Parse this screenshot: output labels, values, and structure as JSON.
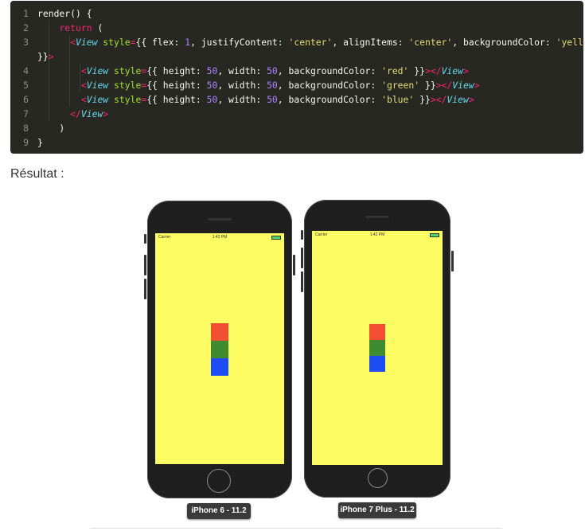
{
  "code": {
    "lines": [
      {
        "n": "1",
        "tokens": [
          {
            "t": "render",
            "c": "tk-pun"
          },
          {
            "t": "() {",
            "c": "tk-pun"
          }
        ]
      },
      {
        "n": "2",
        "tokens": [
          {
            "t": "    ",
            "c": "tk-pun"
          },
          {
            "t": "return",
            "c": "tk-kw"
          },
          {
            "t": " (",
            "c": "tk-pun"
          }
        ]
      },
      {
        "n": "3",
        "tokens": [
          {
            "t": "      ",
            "c": "tk-pun"
          },
          {
            "t": "<",
            "c": "tk-kw"
          },
          {
            "t": "View",
            "c": "tk-tag"
          },
          {
            "t": " style",
            "c": "tk-attr"
          },
          {
            "t": "=",
            "c": "tk-kw"
          },
          {
            "t": "{{ flex: ",
            "c": "tk-pun"
          },
          {
            "t": "1",
            "c": "tk-num"
          },
          {
            "t": ", justifyContent: ",
            "c": "tk-pun"
          },
          {
            "t": "'center'",
            "c": "tk-str"
          },
          {
            "t": ", alignItems: ",
            "c": "tk-pun"
          },
          {
            "t": "'center'",
            "c": "tk-str"
          },
          {
            "t": ", backgroundColor: ",
            "c": "tk-pun"
          },
          {
            "t": "'yellow'",
            "c": "tk-str"
          }
        ]
      },
      {
        "n": "",
        "tokens": [
          {
            "t": "}}",
            "c": "tk-pun"
          },
          {
            "t": ">",
            "c": "tk-kw"
          }
        ]
      },
      {
        "n": "4",
        "tokens": [
          {
            "t": "        ",
            "c": "tk-pun"
          },
          {
            "t": "<",
            "c": "tk-kw"
          },
          {
            "t": "View",
            "c": "tk-tag"
          },
          {
            "t": " style",
            "c": "tk-attr"
          },
          {
            "t": "=",
            "c": "tk-kw"
          },
          {
            "t": "{{ height: ",
            "c": "tk-pun"
          },
          {
            "t": "50",
            "c": "tk-num"
          },
          {
            "t": ", width: ",
            "c": "tk-pun"
          },
          {
            "t": "50",
            "c": "tk-num"
          },
          {
            "t": ", backgroundColor: ",
            "c": "tk-pun"
          },
          {
            "t": "'red'",
            "c": "tk-str"
          },
          {
            "t": " }}",
            "c": "tk-pun"
          },
          {
            "t": "></",
            "c": "tk-kw"
          },
          {
            "t": "View",
            "c": "tk-tag"
          },
          {
            "t": ">",
            "c": "tk-kw"
          }
        ]
      },
      {
        "n": "5",
        "tokens": [
          {
            "t": "        ",
            "c": "tk-pun"
          },
          {
            "t": "<",
            "c": "tk-kw"
          },
          {
            "t": "View",
            "c": "tk-tag"
          },
          {
            "t": " style",
            "c": "tk-attr"
          },
          {
            "t": "=",
            "c": "tk-kw"
          },
          {
            "t": "{{ height: ",
            "c": "tk-pun"
          },
          {
            "t": "50",
            "c": "tk-num"
          },
          {
            "t": ", width: ",
            "c": "tk-pun"
          },
          {
            "t": "50",
            "c": "tk-num"
          },
          {
            "t": ", backgroundColor: ",
            "c": "tk-pun"
          },
          {
            "t": "'green'",
            "c": "tk-str"
          },
          {
            "t": " }}",
            "c": "tk-pun"
          },
          {
            "t": "></",
            "c": "tk-kw"
          },
          {
            "t": "View",
            "c": "tk-tag"
          },
          {
            "t": ">",
            "c": "tk-kw"
          }
        ]
      },
      {
        "n": "6",
        "tokens": [
          {
            "t": "        ",
            "c": "tk-pun"
          },
          {
            "t": "<",
            "c": "tk-kw"
          },
          {
            "t": "View",
            "c": "tk-tag"
          },
          {
            "t": " style",
            "c": "tk-attr"
          },
          {
            "t": "=",
            "c": "tk-kw"
          },
          {
            "t": "{{ height: ",
            "c": "tk-pun"
          },
          {
            "t": "50",
            "c": "tk-num"
          },
          {
            "t": ", width: ",
            "c": "tk-pun"
          },
          {
            "t": "50",
            "c": "tk-num"
          },
          {
            "t": ", backgroundColor: ",
            "c": "tk-pun"
          },
          {
            "t": "'blue'",
            "c": "tk-str"
          },
          {
            "t": " }}",
            "c": "tk-pun"
          },
          {
            "t": "></",
            "c": "tk-kw"
          },
          {
            "t": "View",
            "c": "tk-tag"
          },
          {
            "t": ">",
            "c": "tk-kw"
          }
        ]
      },
      {
        "n": "7",
        "tokens": [
          {
            "t": "      ",
            "c": "tk-pun"
          },
          {
            "t": "</",
            "c": "tk-kw"
          },
          {
            "t": "View",
            "c": "tk-tag"
          },
          {
            "t": ">",
            "c": "tk-kw"
          }
        ]
      },
      {
        "n": "8",
        "tokens": [
          {
            "t": "    )",
            "c": "tk-pun"
          }
        ]
      },
      {
        "n": "9",
        "tokens": [
          {
            "t": "}",
            "c": "tk-pun"
          }
        ]
      }
    ]
  },
  "result_label": "Résultat :",
  "devices": [
    {
      "label": "iPhone 6 - 11.2",
      "status": {
        "carrier": "Carrier",
        "time": "1:42 PM"
      },
      "screen_color": "#fefc63",
      "boxes": [
        {
          "color": "#f24e31"
        },
        {
          "color": "#3f8c30"
        },
        {
          "color": "#1d4cf5"
        }
      ]
    },
    {
      "label": "iPhone 7 Plus - 11.2",
      "status": {
        "carrier": "Carrier",
        "time": "1:42 PM"
      },
      "screen_color": "#fefc63",
      "boxes": [
        {
          "color": "#f24e31"
        },
        {
          "color": "#3f8c30"
        },
        {
          "color": "#1d4cf5"
        }
      ]
    }
  ]
}
